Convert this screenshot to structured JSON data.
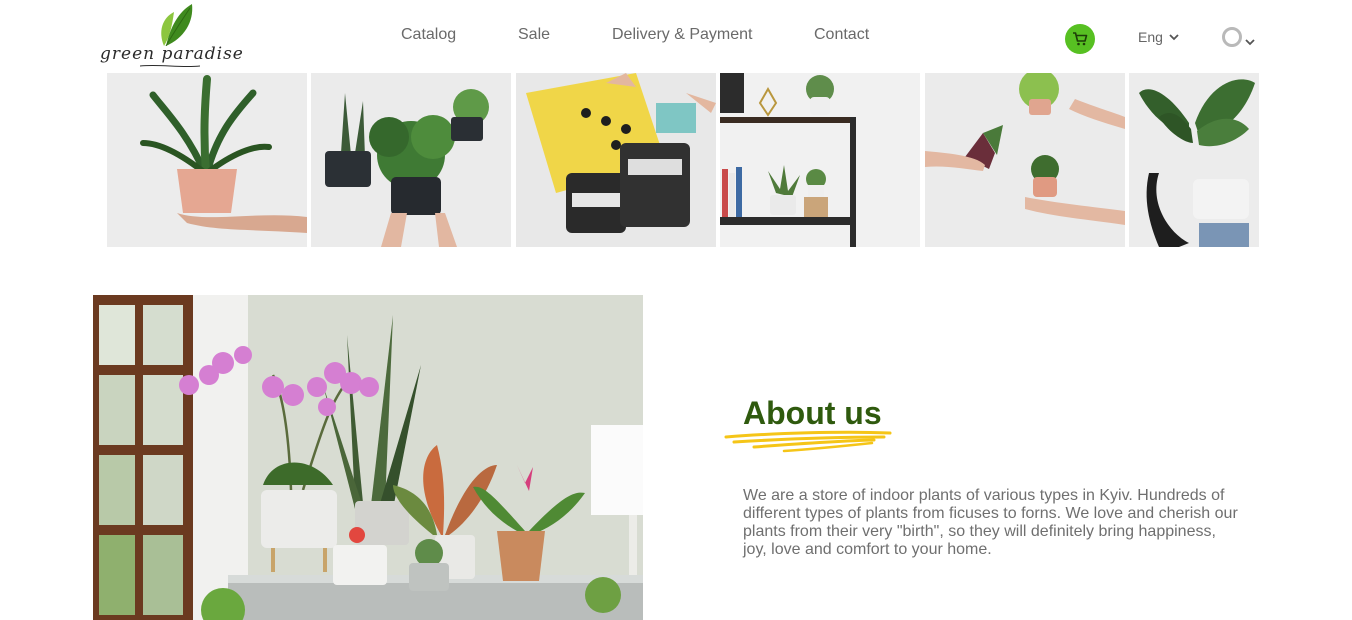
{
  "brand": {
    "logo_text": "green paradise"
  },
  "nav": {
    "items": [
      "Catalog",
      "Sale",
      "Delivery & Payment",
      "Contact"
    ]
  },
  "header": {
    "cart_icon": "cart-icon",
    "language": "Eng",
    "user_icon": "user-icon"
  },
  "gallery": {
    "tiles": [
      "hand-holding-pink-pot-plant",
      "hands-holding-two-potted-plants",
      "hands-with-bag-and-soil-packs",
      "shelf-with-plants",
      "hands-passing-small-plants",
      "person-holding-monstera"
    ]
  },
  "hero": {
    "image": "orchids-and-houseplants-by-window"
  },
  "about": {
    "title": "About us",
    "text": "We are a store of indoor plants of various types in Kyiv. Hundreds of different types of plants from ficuses to forns. We love and cherish our plants from their very \"birth\", so they will definitely bring happiness, joy, love and comfort to your home."
  },
  "colors": {
    "accent_green": "#57c022",
    "title_green": "#2f5a0e",
    "underline_yellow": "#f5c518",
    "text_gray": "#6f6f6f"
  }
}
